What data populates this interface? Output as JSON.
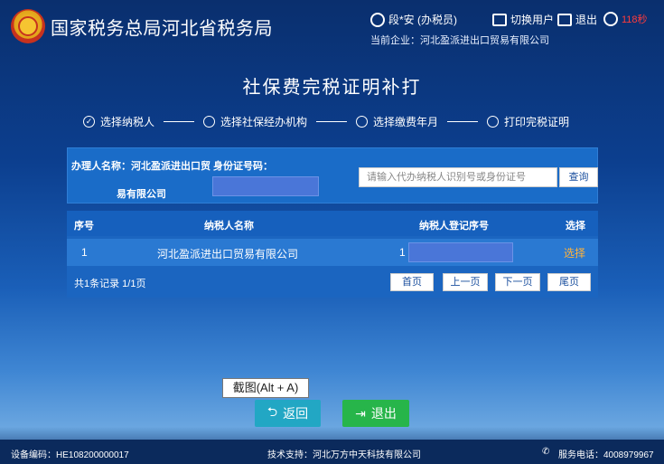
{
  "header": {
    "brand": "国家税务总局河北省税务局",
    "user": "段*安 (办税员)",
    "enterprise": "当前企业：河北盈派进出口贸易有限公司",
    "switch_user": "切换用户",
    "logout": "退出",
    "timer": "118秒"
  },
  "page": {
    "title": "社保费完税证明补打"
  },
  "steps": [
    {
      "label": "选择纳税人",
      "done": true
    },
    {
      "label": "选择社保经办机构",
      "done": false
    },
    {
      "label": "选择缴费年月",
      "done": false
    },
    {
      "label": "打印完税证明",
      "done": false
    }
  ],
  "form": {
    "label_line1": "办理人名称：河北盈派进出口贸 身份证号码：",
    "label_line2": "易有限公司",
    "search_placeholder": "请输入代办纳税人识别号或身份证号",
    "search_button": "查询"
  },
  "table": {
    "headers": [
      "序号",
      "纳税人名称",
      "纳税人登记序号",
      "选择"
    ],
    "rows": [
      {
        "index": "1",
        "name": "河北盈派进出口贸易有限公司",
        "reg_no": "1",
        "action": "选择"
      }
    ],
    "summary": "共1条记录 1/1页",
    "pager": {
      "first": "首页",
      "prev": "上一页",
      "next": "下一页",
      "last": "尾页"
    }
  },
  "tooltip": "截图(Alt + A)",
  "buttons": {
    "back": "返回",
    "exit": "退出"
  },
  "footer": {
    "device": "设备编码：HE108200000017",
    "support": "技术支持：河北万方中天科技有限公司",
    "phone": "服务电话：4008979967"
  }
}
